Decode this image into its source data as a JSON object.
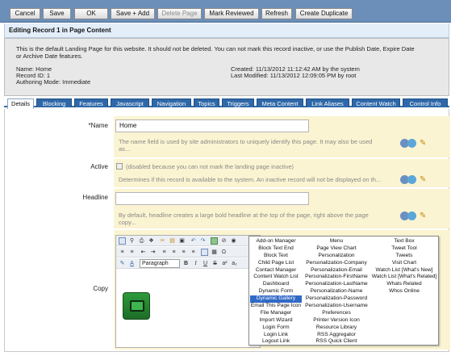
{
  "toolbar": {
    "buttons": [
      {
        "label": "Cancel",
        "disabled": false
      },
      {
        "label": "Save",
        "disabled": false
      },
      {
        "label": "OK",
        "disabled": false
      },
      {
        "label": "Save + Add",
        "disabled": false
      },
      {
        "label": "Delete Page",
        "disabled": true
      },
      {
        "label": "Mark Reviewed",
        "disabled": false
      },
      {
        "label": "Refresh",
        "disabled": false
      },
      {
        "label": "Create Duplicate",
        "disabled": false
      }
    ]
  },
  "header": {
    "title": "Editing Record 1 in Page Content"
  },
  "info": {
    "description_line1": "This is the default Landing Page for this website. It should not be deleted. You can not mark this record inactive, or use the Publish Date, Expire Date",
    "description_line2": "or Archive Date features.",
    "name": "Name: Home",
    "record_id": "Record ID: 1",
    "authoring_mode": "Authoring Mode: Immediate",
    "created": "Created: 11/13/2012 11:12:42 AM by the system",
    "modified": "Last Modified: 11/13/2012 12:09:05 PM by root"
  },
  "tabs": [
    "Details",
    "Blocking",
    "Features",
    "Javascript",
    "Navigation",
    "Topics",
    "Triggers",
    "Meta Content",
    "Link Aliases",
    "Content Watch",
    "Control Info"
  ],
  "active_tab": "Details",
  "fields": {
    "name": {
      "label": "*Name",
      "value": "Home",
      "help_line1": "The name field is used by site administrators to uniquely identify this page. It may also be used",
      "help_line2": "as..."
    },
    "active": {
      "label": "Active",
      "checkbox_text": "(disabled because you can not mark the landing page inactive)",
      "help": "Determines if this record is available to the system. An inactive record will not be displayed on th..."
    },
    "headline": {
      "label": "Headline",
      "value": "",
      "help_line1": "By default, headline creates a large bold headline at the top of the page, right above the page",
      "help_line2": "copy..."
    },
    "copy": {
      "label": "Copy",
      "paragraph_format": "Paragraph"
    }
  },
  "menu": {
    "col1": [
      "Add-on Manager",
      "Block Text End",
      "Block Text",
      "Child Page List",
      "Contact Manager",
      "Content Watch List",
      "Dashboard",
      "Dynamic Form",
      "Dynamic Gallery",
      "Email This Page Icon",
      "File Manager",
      "Import Wizard",
      "Login Form",
      "Login Link",
      "Logout Link"
    ],
    "col2": [
      "Menu",
      "Page View Chart",
      "Personalization",
      "Personalization-Company",
      "Personalization-Email",
      "Personalization-FirstName",
      "Personalization-LastName",
      "Personalization-Name",
      "Personalization-Password",
      "Personalization-Username",
      "Preferences",
      "Printer Version Icon",
      "Resource Library",
      "RSS Aggregator",
      "RSS Quick Client"
    ],
    "col3": [
      "Text Box",
      "Tweet Tool",
      "Tweets",
      "Visit Chart",
      "Watch List [What's New]",
      "Watch List [What's Related]",
      "Whats Related",
      "Whos Online"
    ],
    "selected": "Dynamic Gallery"
  },
  "colors": {
    "toolbar_bg": "#6b8fb8",
    "tab_bg": "#2f68a8",
    "field_row_bg": "#fbf4d2",
    "menu_selected": "#3169c6"
  }
}
